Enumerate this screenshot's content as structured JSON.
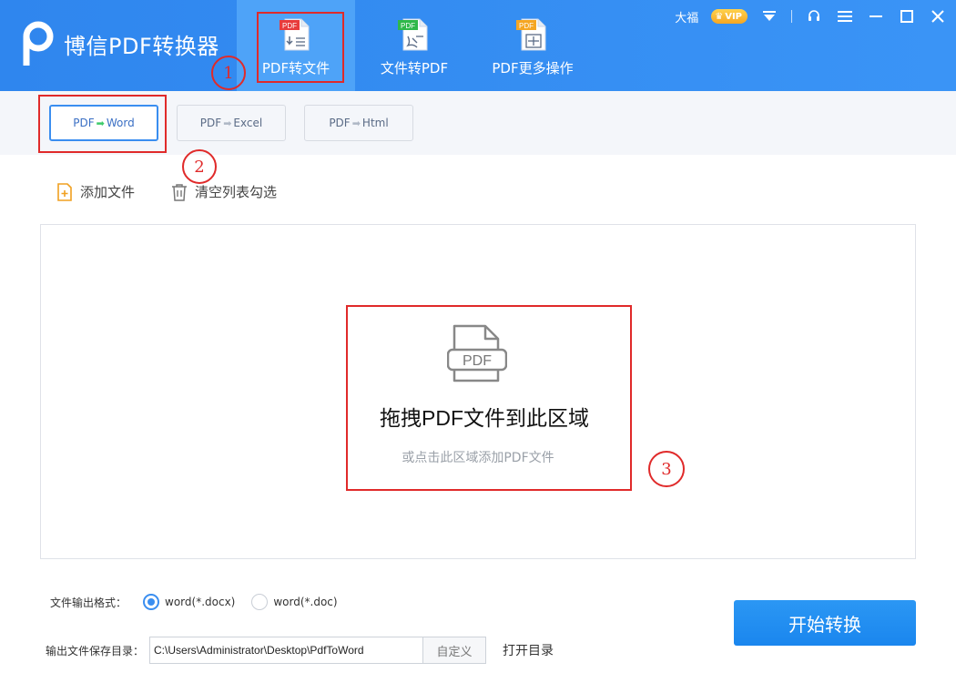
{
  "app": {
    "title": "博信PDF转换器"
  },
  "nav": {
    "tabs": [
      {
        "label": "PDF转文件",
        "icon_badge": "PDF",
        "badge_color": "#e83b3b"
      },
      {
        "label": "文件转PDF",
        "icon_badge": "PDF",
        "badge_color": "#2fb84a"
      },
      {
        "label": "PDF更多操作",
        "icon_badge": "PDF",
        "badge_color": "#f5a623"
      }
    ]
  },
  "window": {
    "user_name": "大福",
    "vip_label": "VIP"
  },
  "subtabs": [
    {
      "from": "PDF",
      "to": "Word"
    },
    {
      "from": "PDF",
      "to": "Excel"
    },
    {
      "from": "PDF",
      "to": "Html"
    }
  ],
  "actions": {
    "add_file": "添加文件",
    "clear_list": "清空列表勾选"
  },
  "drop": {
    "icon_text": "PDF",
    "title": "拖拽PDF文件到此区域",
    "subtitle": "或点击此区域添加PDF文件"
  },
  "output": {
    "format_label": "文件输出格式：",
    "options": [
      "word(*.docx)",
      "word(*.doc)"
    ],
    "selected": "word(*.docx)",
    "dir_label": "输出文件保存目录：",
    "dir_value": "C:\\Users\\Administrator\\Desktop\\PdfToWord",
    "custom_label": "自定义",
    "open_dir_label": "打开目录"
  },
  "start_button": {
    "label": "开始转换"
  },
  "annotations": [
    "1",
    "2",
    "3"
  ],
  "colors": {
    "primary": "#2f86ee",
    "annotation": "#e02a2a",
    "active_tab": "#4ea3f8"
  }
}
